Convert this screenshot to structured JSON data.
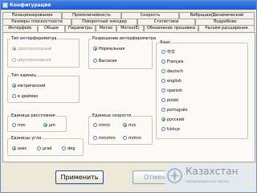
{
  "window": {
    "title": "Конфигурация"
  },
  "tabs_row1": [
    "Позиционирование",
    "Прямолинейность",
    "Скорость",
    "Вибрации/Динамический"
  ],
  "tabs_row2": [
    "Размеры плоскостности",
    "Поворотный энкодер",
    "Статистики",
    "Подробнее"
  ],
  "tabs_row3": [
    "Интерфейс",
    "Общее",
    "Параметры",
    "Метео",
    "Метео(Е)",
    "Обновление прошивки",
    "Разъём расширения"
  ],
  "active_tab": "Общее",
  "groups": {
    "interferometer_type": {
      "label": "Тип интерферометра",
      "options": [
        {
          "label": "однопроходный",
          "selected": true,
          "disabled": true
        },
        {
          "label": "двухпроходный",
          "selected": false,
          "disabled": true
        }
      ]
    },
    "interferometer_resolution": {
      "label": "Разрешение интерферометра",
      "options": [
        {
          "label": "Нормальная",
          "selected": true
        },
        {
          "label": "Высокая",
          "selected": false
        }
      ]
    },
    "language": {
      "label": "Язык",
      "options": [
        {
          "label": "中文",
          "selected": false
        },
        {
          "label": "Français",
          "selected": false
        },
        {
          "label": "deutsch",
          "selected": false
        },
        {
          "label": "english",
          "selected": false
        },
        {
          "label": "spanish",
          "selected": false
        },
        {
          "label": "polski",
          "selected": false
        },
        {
          "label": "português",
          "selected": false
        },
        {
          "label": "русский",
          "selected": true
        },
        {
          "label": "türkçe",
          "selected": false
        }
      ]
    },
    "units_type": {
      "label": "Тип единиц",
      "options": [
        {
          "label": "метрический",
          "selected": true
        },
        {
          "label": "в дюймах",
          "selected": false
        }
      ]
    },
    "distance_units": {
      "label": "Единица расстояния",
      "options": [
        {
          "label": "mm",
          "selected": false
        },
        {
          "label": "μm",
          "selected": true
        }
      ]
    },
    "speed_units": {
      "label": "Единица скорости",
      "options": [
        {
          "label": "mm/s",
          "selected": false
        },
        {
          "label": "m/s",
          "selected": true
        },
        {
          "label": "mm/min",
          "selected": false
        },
        {
          "label": "m/min",
          "selected": false
        }
      ]
    },
    "angle_units": {
      "label": "Единицы угла",
      "options": [
        {
          "label": "asec",
          "selected": true
        },
        {
          "label": "μrad",
          "selected": false
        },
        {
          "label": "deg",
          "selected": false
        }
      ]
    }
  },
  "buttons": {
    "apply": "Применить",
    "cancel": "Отмена"
  },
  "watermark": {
    "title": "Казахстан",
    "subtitle": "информационный портал"
  }
}
